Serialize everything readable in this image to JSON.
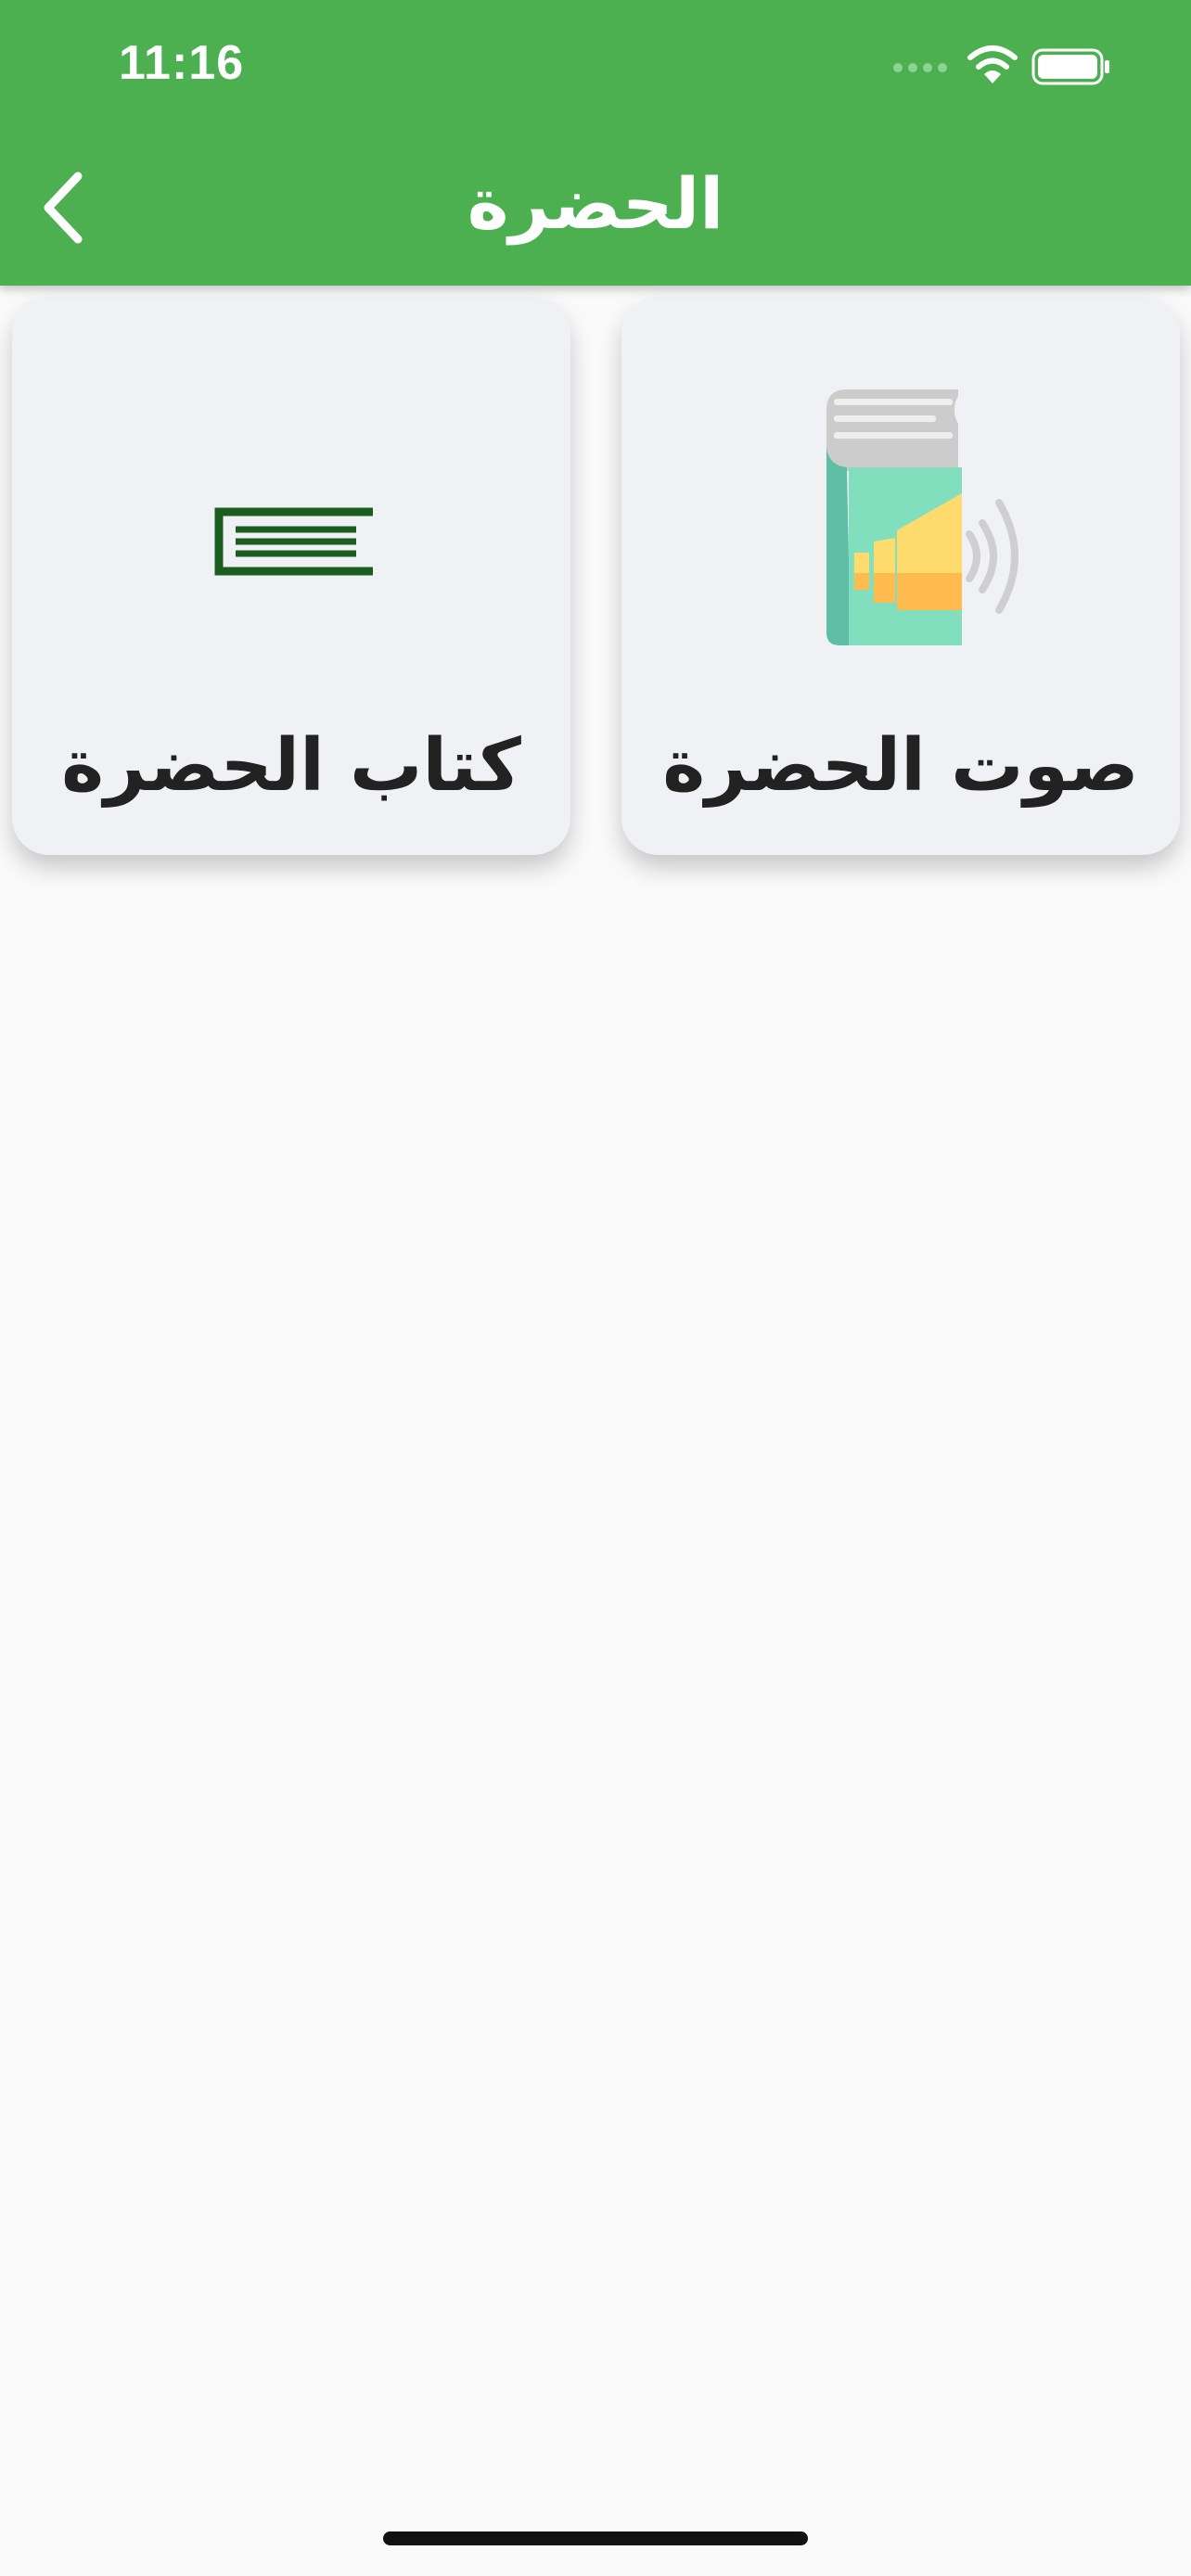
{
  "status_bar": {
    "time": "11:16",
    "icons": [
      "cellular-signal-icon",
      "wifi-icon",
      "battery-icon"
    ]
  },
  "header": {
    "title": "الحضرة",
    "back_icon": "chevron-left-icon",
    "background_color": "#4caf50"
  },
  "cards": [
    {
      "label": "صوت الحضرة",
      "icon": "audio-book-speaker-icon"
    },
    {
      "label": "كتاب الحضرة",
      "icon": "book-lines-icon",
      "icon_color": "#1b5e20"
    }
  ]
}
